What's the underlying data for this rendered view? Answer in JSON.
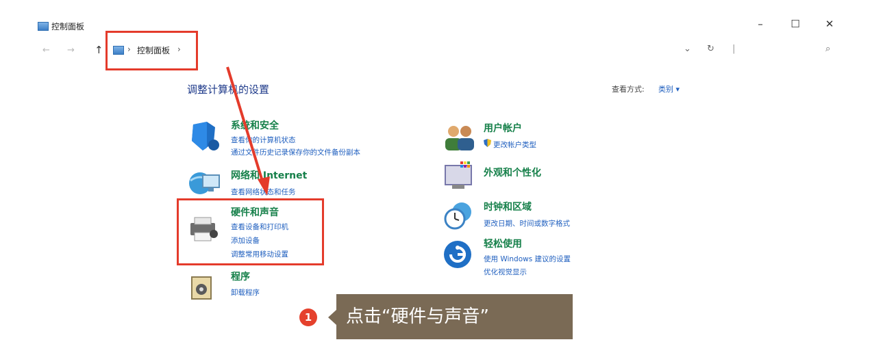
{
  "window": {
    "title": "控制面板",
    "minimize": "–",
    "maximize": "☐",
    "close": "✕"
  },
  "address": {
    "back": "←",
    "forward": "→",
    "up": "↑",
    "separator": "›",
    "crumb": "控制面板",
    "dropdown": "⌄",
    "refresh": "↻",
    "divider": "|",
    "search_icon": "⌕"
  },
  "content": {
    "heading": "调整计算机的设置",
    "view_label": "查看方式:",
    "view_value": "类别 ▾"
  },
  "categories_left": [
    {
      "title": "系统和安全",
      "links": [
        "查看你的计算机状态",
        "通过文件历史记录保存你的文件备份副本"
      ]
    },
    {
      "title": "网络和 Internet",
      "links": [
        "查看网络状态和任务"
      ]
    },
    {
      "title": "硬件和声音",
      "links": [
        "查看设备和打印机",
        "添加设备",
        "调整常用移动设置"
      ]
    },
    {
      "title": "程序",
      "links": [
        "卸载程序"
      ]
    }
  ],
  "categories_right": [
    {
      "title": "用户帐户",
      "links": [
        "更改帐户类型"
      ]
    },
    {
      "title": "外观和个性化",
      "links": []
    },
    {
      "title": "时钟和区域",
      "links": [
        "更改日期、时间或数字格式"
      ]
    },
    {
      "title": "轻松使用",
      "links": [
        "使用 Windows 建议的设置",
        "优化视觉显示"
      ]
    }
  ],
  "annotation": {
    "step": "1",
    "text": "点击“硬件与声音”",
    "highlight_color": "#e43b2b",
    "tooltip_color": "#7a6a55"
  },
  "colors": {
    "category_title": "#16804a",
    "link": "#1f5fbf",
    "heading": "#1e3a8a"
  }
}
